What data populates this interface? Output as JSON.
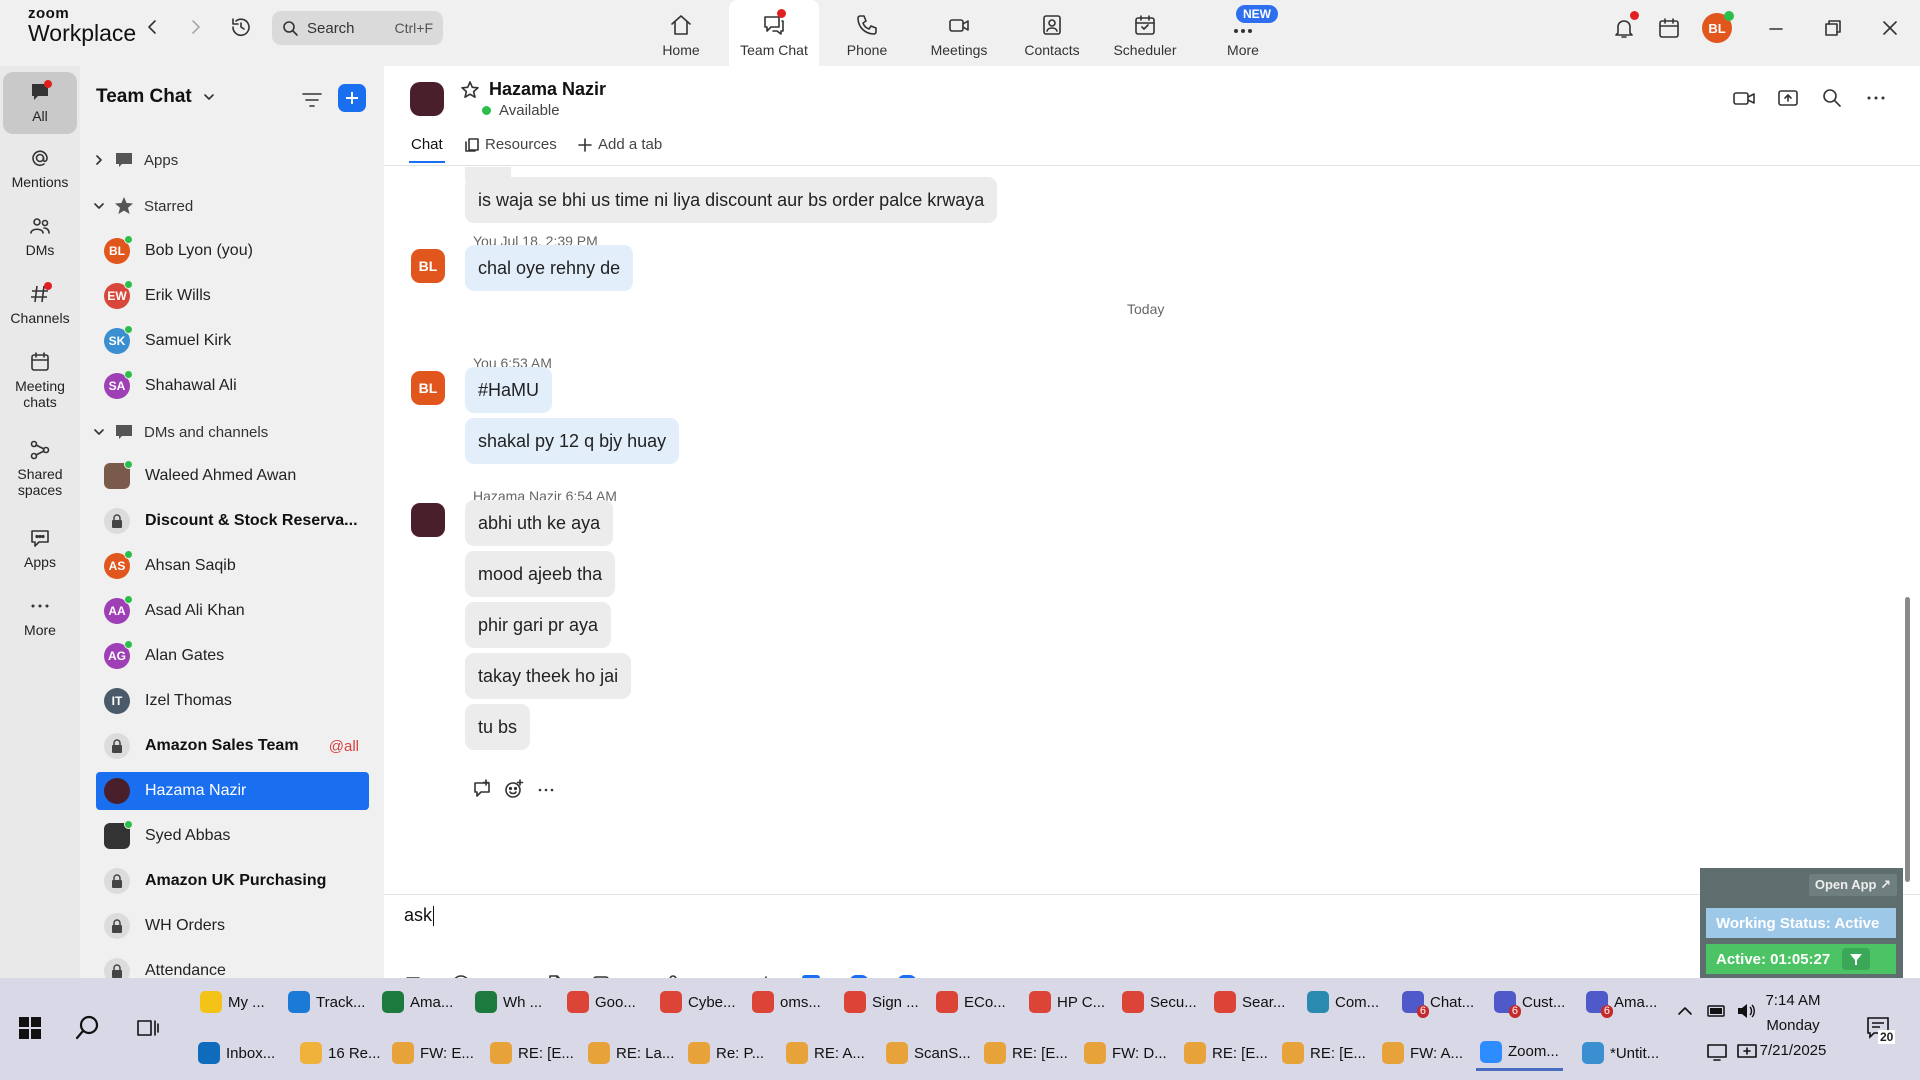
{
  "app": {
    "logo_line1": "zoom",
    "logo_line2": "Workplace"
  },
  "search": {
    "placeholder": "Search",
    "shortcut": "Ctrl+F"
  },
  "top_nav": [
    {
      "label": "Home",
      "icon": "home-icon"
    },
    {
      "label": "Team Chat",
      "icon": "chat-icon",
      "active": true
    },
    {
      "label": "Phone",
      "icon": "phone-icon"
    },
    {
      "label": "Meetings",
      "icon": "video-icon"
    },
    {
      "label": "Contacts",
      "icon": "contacts-icon"
    },
    {
      "label": "Scheduler",
      "icon": "calendar-icon"
    },
    {
      "label": "More",
      "icon": "more-icon",
      "badge": "NEW"
    }
  ],
  "user": {
    "initials": "BL"
  },
  "rail": [
    {
      "label": "All",
      "icon": "chat-bubble-icon"
    },
    {
      "label": "Mentions",
      "icon": "at-icon"
    },
    {
      "label": "DMs",
      "icon": "people-icon"
    },
    {
      "label": "Channels",
      "icon": "hash-icon"
    },
    {
      "label": "Meeting",
      "label2": "chats",
      "icon": "calendar-icon"
    },
    {
      "label": "Shared",
      "label2": "spaces",
      "icon": "share-icon"
    },
    {
      "label": "Apps",
      "icon": "apps-icon"
    },
    {
      "label": "More",
      "icon": "more-icon"
    }
  ],
  "sidebar": {
    "title": "Team Chat",
    "sections": {
      "apps": "Apps",
      "starred": "Starred",
      "dms": "DMs and channels"
    },
    "starred": [
      {
        "name": "Bob Lyon (you)",
        "initials": "BL",
        "color": "#e0561c"
      },
      {
        "name": "Erik Wills",
        "initials": "EW",
        "color": "#d9473c"
      },
      {
        "name": "Samuel Kirk",
        "initials": "SK",
        "color": "#3a8fd0"
      },
      {
        "name": "Shahawal Ali",
        "initials": "SA",
        "color": "#9e3fb5"
      }
    ],
    "dms": [
      {
        "name": "Waleed Ahmed Awan",
        "initials": "",
        "color": "#7a5a4a"
      },
      {
        "name": "Discount & Stock Reserva...",
        "initials": "",
        "color": "#dcdcdc",
        "lock": true,
        "bold": true
      },
      {
        "name": "Ahsan Saqib",
        "initials": "AS",
        "color": "#e0561c"
      },
      {
        "name": "Asad Ali Khan",
        "initials": "AA",
        "color": "#9e3fb5"
      },
      {
        "name": "Alan Gates",
        "initials": "AG",
        "color": "#9e3fb5"
      },
      {
        "name": "Izel Thomas",
        "initials": "IT",
        "color": "#4a5a6a"
      },
      {
        "name": "Amazon Sales Team",
        "initials": "",
        "color": "#dcdcdc",
        "lock": true,
        "bold": true,
        "mention": "@all"
      },
      {
        "name": "Hazama Nazir",
        "initials": "",
        "color": "#4a1f2c",
        "selected": true
      },
      {
        "name": "Syed Abbas",
        "initials": "",
        "color": "#333"
      },
      {
        "name": "Amazon UK Purchasing",
        "initials": "",
        "color": "#dcdcdc",
        "lock": true,
        "bold": true
      },
      {
        "name": "WH Orders",
        "initials": "",
        "color": "#dcdcdc",
        "lock": true
      },
      {
        "name": "Attendance",
        "initials": "",
        "color": "#dcdcdc",
        "lock": true
      }
    ]
  },
  "chat": {
    "peer_name": "Hazama Nazir",
    "peer_status": "Available",
    "tabs": {
      "chat": "Chat",
      "resources": "Resources",
      "add": "Add a tab"
    },
    "messages": [
      {
        "text": "is waja se bhi us time ni liya discount aur bs order palce krwaya",
        "from": "them"
      },
      {
        "meta": "You Jul 18, 2:39 PM"
      },
      {
        "text": "chal oye rehny de",
        "from": "me"
      },
      {
        "divider": "Today"
      },
      {
        "meta": "You 6:53 AM"
      },
      {
        "text": "#HaMU",
        "from": "me"
      },
      {
        "text": "shakal py 12 q bjy huay",
        "from": "me"
      },
      {
        "meta": "Hazama Nazir 6:54 AM"
      },
      {
        "text": "abhi uth ke aya",
        "from": "them"
      },
      {
        "text": "mood ajeeb tha",
        "from": "them"
      },
      {
        "text": "phir gari pr aya",
        "from": "them"
      },
      {
        "text": "takay theek ho jai",
        "from": "them"
      },
      {
        "text": "tu bs",
        "from": "them"
      }
    ],
    "composer_text": "ask"
  },
  "widget": {
    "open_app": "Open App ↗",
    "working_status": "Working Status: Active",
    "active_timer": "Active: 01:05:27"
  },
  "taskbar": {
    "row1": [
      {
        "label": "My ...",
        "color": "#f3c318"
      },
      {
        "label": "Track...",
        "color": "#1b7ad6"
      },
      {
        "label": "Ama...",
        "color": "#1d7a3e"
      },
      {
        "label": "Wh ...",
        "color": "#1d7a3e"
      },
      {
        "label": "Goo...",
        "color": "#db4437"
      },
      {
        "label": "Cybe...",
        "color": "#db4437"
      },
      {
        "label": "oms...",
        "color": "#db4437"
      },
      {
        "label": "Sign ...",
        "color": "#db4437"
      },
      {
        "label": "ECo...",
        "color": "#db4437"
      },
      {
        "label": "HP C...",
        "color": "#db4437"
      },
      {
        "label": "Secu...",
        "color": "#db4437"
      },
      {
        "label": "Sear...",
        "color": "#db4437"
      },
      {
        "label": "Com...",
        "color": "#2a8ab0"
      },
      {
        "label": "Chat...",
        "color": "#5059c9",
        "badge": "6"
      },
      {
        "label": "Cust...",
        "color": "#5059c9",
        "badge": "6"
      },
      {
        "label": "Ama...",
        "color": "#5059c9",
        "badge": "6"
      }
    ],
    "row2": [
      {
        "label": "Inbox...",
        "color": "#0f6cbd"
      },
      {
        "label": "16 Re...",
        "color": "#f0b23a"
      },
      {
        "label": "FW: E...",
        "color": "#e8a23a"
      },
      {
        "label": "RE: [E...",
        "color": "#e8a23a"
      },
      {
        "label": "RE: La...",
        "color": "#e8a23a"
      },
      {
        "label": "Re: P...",
        "color": "#e8a23a"
      },
      {
        "label": "RE: A...",
        "color": "#e8a23a"
      },
      {
        "label": "ScanS...",
        "color": "#e8a23a"
      },
      {
        "label": "RE: [E...",
        "color": "#e8a23a"
      },
      {
        "label": "FW: D...",
        "color": "#e8a23a"
      },
      {
        "label": "RE: [E...",
        "color": "#e8a23a"
      },
      {
        "label": "RE: [E...",
        "color": "#e8a23a"
      },
      {
        "label": "FW: A...",
        "color": "#e8a23a"
      },
      {
        "label": "Zoom...",
        "color": "#2d8cff",
        "active": true
      },
      {
        "label": "*Untit...",
        "color": "#3a8fd0"
      }
    ],
    "clock": {
      "time": "7:14 AM",
      "day": "Monday",
      "date": "7/21/2025"
    },
    "notifications": "20"
  }
}
